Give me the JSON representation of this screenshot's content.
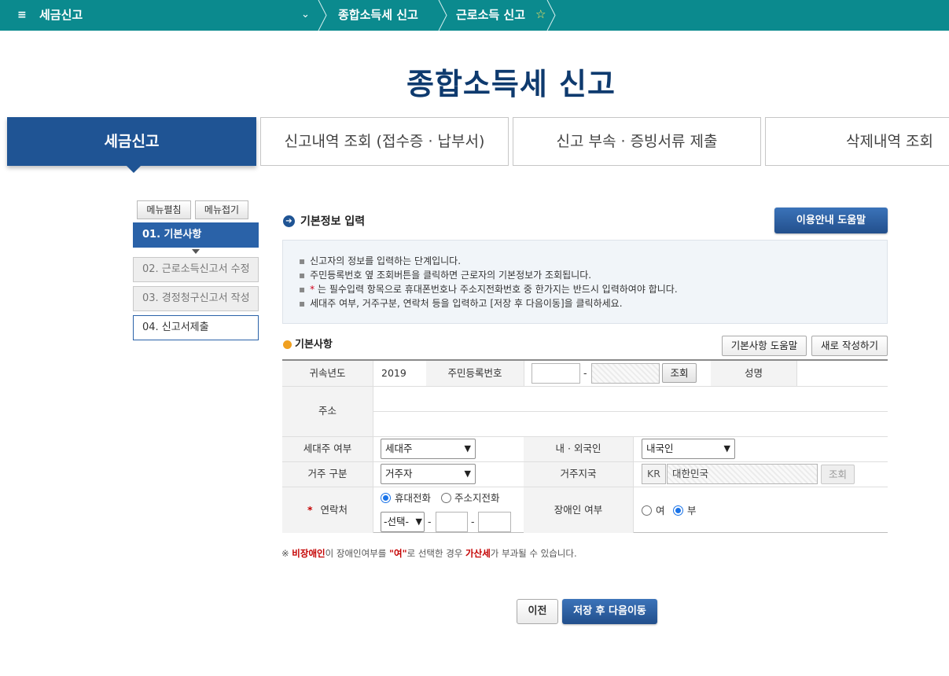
{
  "topbar": {
    "menu_icon": "≡",
    "root_label": "세금신고",
    "caret": "⌄",
    "crumb1": "종합소득세 신고",
    "crumb2": "근로소득 신고",
    "star": "☆"
  },
  "page_title": "종합소득세 신고",
  "tabs": [
    {
      "label": "세금신고",
      "active": true
    },
    {
      "label": "신고내역 조회 (접수증 · 납부서)"
    },
    {
      "label": "신고 부속 · 증빙서류 제출"
    },
    {
      "label": "삭제내역 조회"
    }
  ],
  "sidebar": {
    "expand_label": "메뉴펼침",
    "collapse_label": "메뉴접기",
    "steps": [
      {
        "label": "01. 기본사항",
        "active": true
      },
      {
        "label": "02. 근로소득신고서 수정"
      },
      {
        "label": "03. 경정청구신고서 작성"
      },
      {
        "label": "04. 신고서제출"
      }
    ]
  },
  "section": {
    "icon": "➔",
    "title": "기본정보 입력",
    "help_button": "이용안내 도움말"
  },
  "info": {
    "bullet": "▪",
    "lines": [
      "신고자의 정보를 입력하는 단계입니다.",
      "주민등록번호 옆 조회버튼을 클릭하면 근로자의 기본정보가 조회됩니다.",
      "는 필수입력 항목으로 휴대폰번호나 주소지전화번호 중 한가지는 반드시 입력하여야 합니다.",
      "세대주 여부, 거주구분, 연락처 등을 입력하고 [저장 후 다음이동]을 클릭하세요."
    ],
    "req_mark": "*"
  },
  "subsection": {
    "title": "기본사항",
    "help_button": "기본사항 도움말",
    "new_button": "새로 작성하기"
  },
  "form": {
    "year_label": "귀속년도",
    "year_value": "2019",
    "rrn_label": "주민등록번호",
    "rrn_dash": "-",
    "rrn_lookup": "조회",
    "name_label": "성명",
    "address_label": "주소",
    "household_label": "세대주 여부",
    "household_value": "세대주",
    "nationality_label": "내 · 외국인",
    "nationality_value": "내국인",
    "residence_label": "거주 구분",
    "residence_value": "거주자",
    "country_label": "거주지국",
    "country_code": "KR",
    "country_name": "대한민국",
    "country_lookup": "조회",
    "contact_req": "*",
    "contact_label": "연락처",
    "contact_opt_mobile": "휴대전화",
    "contact_opt_home": "주소지전화",
    "phone_prefix": "-선택-",
    "phone_dash": "-",
    "disability_label": "장애인 여부",
    "disability_yes": "여",
    "disability_no": "부"
  },
  "notice": {
    "mark": "※",
    "part1": "비장애인",
    "part2": "이 장애인여부를 ",
    "part3": "\"여\"",
    "part4": "로 선택한 경우 ",
    "part5": "가산세",
    "part6": "가 부과될 수 있습니다."
  },
  "buttons": {
    "prev": "이전",
    "next": "저장 후 다음이동"
  },
  "colors": {
    "topbar": "#0b8a8e",
    "primary": "#1f5494",
    "title": "#0e3a6e",
    "required": "#d0021b"
  }
}
